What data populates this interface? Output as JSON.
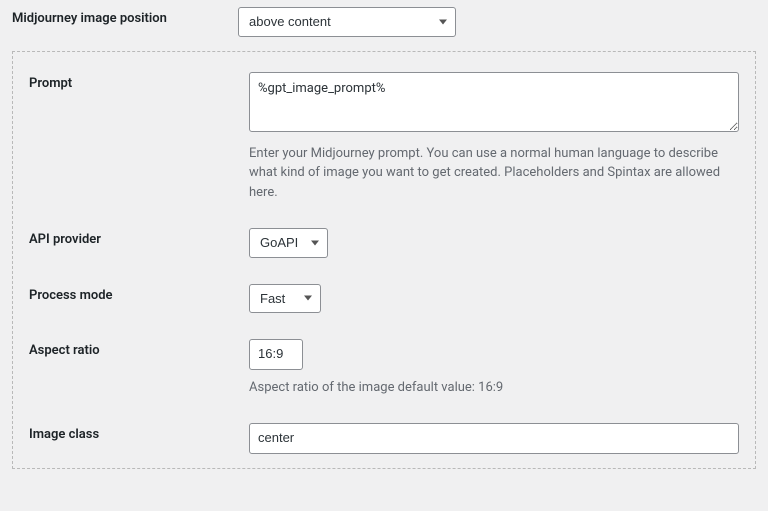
{
  "position": {
    "label": "Midjourney image position",
    "value": "above content"
  },
  "prompt": {
    "label": "Prompt",
    "value": "%gpt_image_prompt%",
    "description": "Enter your Midjourney prompt. You can use a normal human language to describe what kind of image you want to get created. Placeholders and Spintax are allowed here."
  },
  "api_provider": {
    "label": "API provider",
    "value": "GoAPI"
  },
  "process_mode": {
    "label": "Process mode",
    "value": "Fast"
  },
  "aspect_ratio": {
    "label": "Aspect ratio",
    "value": "16:9",
    "description": "Aspect ratio of the image default value: 16:9"
  },
  "image_class": {
    "label": "Image class",
    "value": "center"
  }
}
